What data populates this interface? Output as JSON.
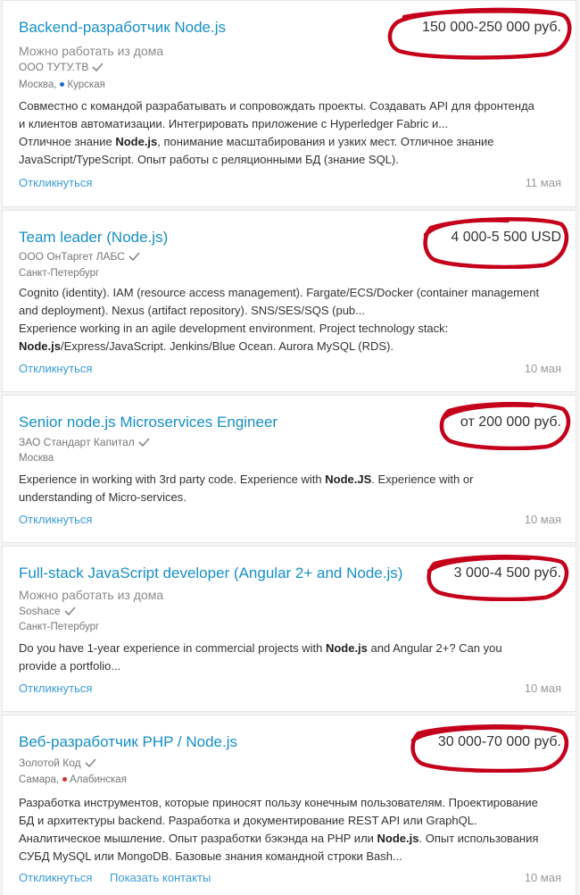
{
  "colors": {
    "link": "#168fc4",
    "annotation_ring": "#c4001a",
    "metro_blue": "#1b6fc9",
    "metro_red": "#d32f2f"
  },
  "vacancies": [
    {
      "title": "Backend-разработчик Node.js",
      "salary": "150 000-250 000 руб.",
      "remote": "Можно работать из дома",
      "company": "ООО ТУТУ.ТВ",
      "city": "Москва,",
      "metro": "Курская",
      "desc": [
        {
          "t": "Совместно с командой разрабатывать и сопровождать проекты. Создавать API для фронтенда"
        },
        {
          "t": "и клиентов автоматизации. Интегрировать приложение с Hyperledger Fabric и..."
        },
        {
          "t": "Отличное знание ",
          "b": "Node.js",
          "a": ", понимание масштабирования и узких мест. Отличное знание"
        },
        {
          "t": "JavaScript/TypeScript. Опыт работы с реляционными БД (знание SQL)."
        }
      ],
      "action": "Откликнуться",
      "date": "11 мая"
    },
    {
      "title": "Team leader (Node.js)",
      "salary": "4 000-5 500 USD",
      "company": "ООО ОнТаргет ЛАБС",
      "city": "Санкт-Петербург",
      "desc": [
        {
          "t": "Cognito (identity). IAM (resource access management). Fargate/ECS/Docker (container management"
        },
        {
          "t": "and deployment). Nexus (artifact repository). SNS/SES/SQS (pub..."
        },
        {
          "t": "Experience working in an agile development environment. Project technology stack:"
        },
        {
          "t": "",
          "b": "Node.js",
          "a": "/Express/JavaScript. Jenkins/Blue Ocean. Aurora MySQL (RDS)."
        }
      ],
      "action": "Откликнуться",
      "date": "10 мая"
    },
    {
      "title": "Senior node.js Microservices Engineer",
      "salary": "от 200 000 руб.",
      "company": "ЗАО Стандарт Капитал",
      "city": "Москва",
      "desc": [
        {
          "t": "Experience in working with 3rd party code. Experience with ",
          "b": "Node.JS",
          "a": ". Experience with or"
        },
        {
          "t": "understanding of Micro-services."
        }
      ],
      "action": "Откликнуться",
      "date": "10 мая"
    },
    {
      "title": "Full-stack JavaScript developer (Angular 2+ and Node.js)",
      "salary": "3 000-4 500 руб.",
      "remote": "Можно работать из дома",
      "company": "Soshace",
      "city": "Санкт-Петербург",
      "desc": [
        {
          "t": "Do you have 1-year experience in commercial projects with ",
          "b": "Node.js",
          "a": " and Angular 2+? Can you"
        },
        {
          "t": "provide a portfolio..."
        }
      ],
      "action": "Откликнуться",
      "date": "10 мая"
    },
    {
      "title": "Веб-разработчик PHP / Node.js",
      "salary": "30 000-70 000 руб.",
      "company": "Золотой Код",
      "city": "Самара,",
      "metro": "Алабинская",
      "desc": [
        {
          "t": "Разработка инструментов, которые приносят пользу конечным пользователям. Проектирование"
        },
        {
          "t": "БД и архитектуры backend. Разработка и документирование REST API или GraphQL."
        },
        {
          "t": "Аналитическое мышление. Опыт разработки бэкэнда на PHP или ",
          "b": "Node.js",
          "a": ". Опыт использования"
        },
        {
          "t": "СУБД MySQL или MongoDB. Базовые знания командной строки Bash..."
        }
      ],
      "action": "Откликнуться",
      "action2": "Показать контакты",
      "date": "10 мая"
    }
  ]
}
